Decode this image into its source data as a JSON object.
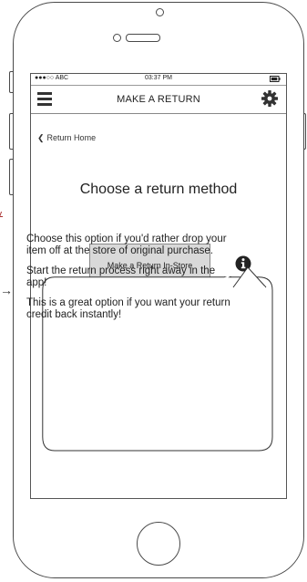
{
  "status_bar": {
    "carrier": "●●●○○ ABC",
    "time": "03:37 PM",
    "battery_icon": "battery-icon"
  },
  "nav": {
    "title": "MAKE A RETURN",
    "menu_icon": "hamburger-menu-icon",
    "settings_icon": "gear-icon"
  },
  "back_link": {
    "label": "Return Home",
    "icon": "chevron-left-icon"
  },
  "page": {
    "heading": "Choose a return method",
    "instore_button": "Make a Return In-Store",
    "info_icon": "info-icon"
  },
  "tooltip": {
    "paragraphs": [
      "Choose this option if you'd rather drop your item off at the store of original purchase.",
      "Start the return process right away in the app!",
      "This is a great option if you want your return credit back instantly!"
    ]
  },
  "annotation": {
    "arrow": "→"
  },
  "colors": {
    "frame": "#4a4a4a",
    "button_fill": "#d9d9d9",
    "annotation_tick": "#aa3333"
  }
}
